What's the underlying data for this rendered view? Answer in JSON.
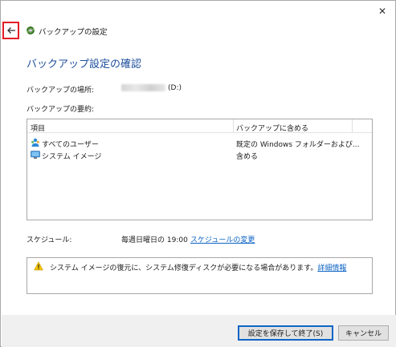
{
  "window": {
    "close_glyph": "✕",
    "title": "バックアップの設定"
  },
  "page": {
    "heading": "バックアップ設定の確認",
    "location_label": "バックアップの場所:",
    "location_drive": "(D:)",
    "summary_label": "バックアップの要約:"
  },
  "list": {
    "headers": [
      "項目",
      "バックアップに含める"
    ],
    "rows": [
      {
        "name": "すべてのユーザー",
        "include": "既定の Windows フォルダーおよび...",
        "icon": "users-icon"
      },
      {
        "name": "システム イメージ",
        "include": "含める",
        "icon": "monitor-icon"
      }
    ]
  },
  "schedule": {
    "label": "スケジュール:",
    "value": "毎週日曜日の 19:00",
    "change_link": "スケジュールの変更"
  },
  "warning": {
    "text": "システム イメージの復元に、システム修復ディスクが必要になる場合があります。",
    "link": "詳細情報",
    "icon": "warning-icon"
  },
  "footer": {
    "save_label": "設定を保存して終了(S)",
    "cancel_label": "キャンセル"
  },
  "colors": {
    "heading": "#1d4e9c",
    "link": "#0b63c4",
    "back_highlight": "#e41e26"
  }
}
